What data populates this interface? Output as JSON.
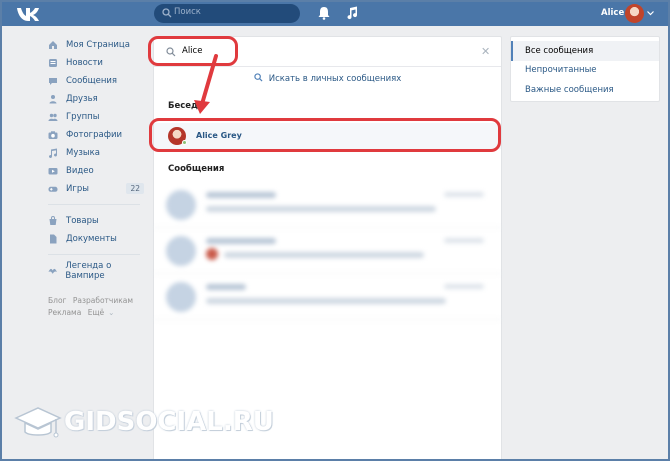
{
  "header": {
    "search_placeholder": "Поиск",
    "user_name": "Alice"
  },
  "menu": {
    "items": [
      {
        "label": "Моя Страница",
        "icon": "home-icon"
      },
      {
        "label": "Новости",
        "icon": "news-icon"
      },
      {
        "label": "Сообщения",
        "icon": "messages-icon"
      },
      {
        "label": "Друзья",
        "icon": "friends-icon"
      },
      {
        "label": "Группы",
        "icon": "groups-icon"
      },
      {
        "label": "Фотографии",
        "icon": "photo-icon"
      },
      {
        "label": "Музыка",
        "icon": "music-icon"
      },
      {
        "label": "Видео",
        "icon": "video-icon"
      },
      {
        "label": "Игры",
        "icon": "games-icon",
        "badge": "22"
      }
    ],
    "items2": [
      {
        "label": "Товары",
        "icon": "goods-icon"
      },
      {
        "label": "Документы",
        "icon": "docs-icon"
      }
    ],
    "items3": [
      {
        "label": "Легенда о Вампире",
        "icon": "app-icon"
      }
    ],
    "footer": [
      "Блог",
      "Разработчикам",
      "Реклама",
      "Ещё"
    ]
  },
  "messenger": {
    "search_value": "Alice",
    "search_private_label": "Искать в личных сообщениях",
    "section_conversations": "Беседы",
    "section_messages": "Сообщения",
    "conversation": {
      "name": "Alice Grey"
    }
  },
  "filters": {
    "items": [
      "Все сообщения",
      "Непрочитанные",
      "Важные сообщения"
    ],
    "active_index": 0
  },
  "watermark": {
    "text": "GIDSOCIAL.RU"
  },
  "colors": {
    "header": "#4a76a8",
    "link": "#2a5885",
    "highlight": "#e03a3e"
  }
}
